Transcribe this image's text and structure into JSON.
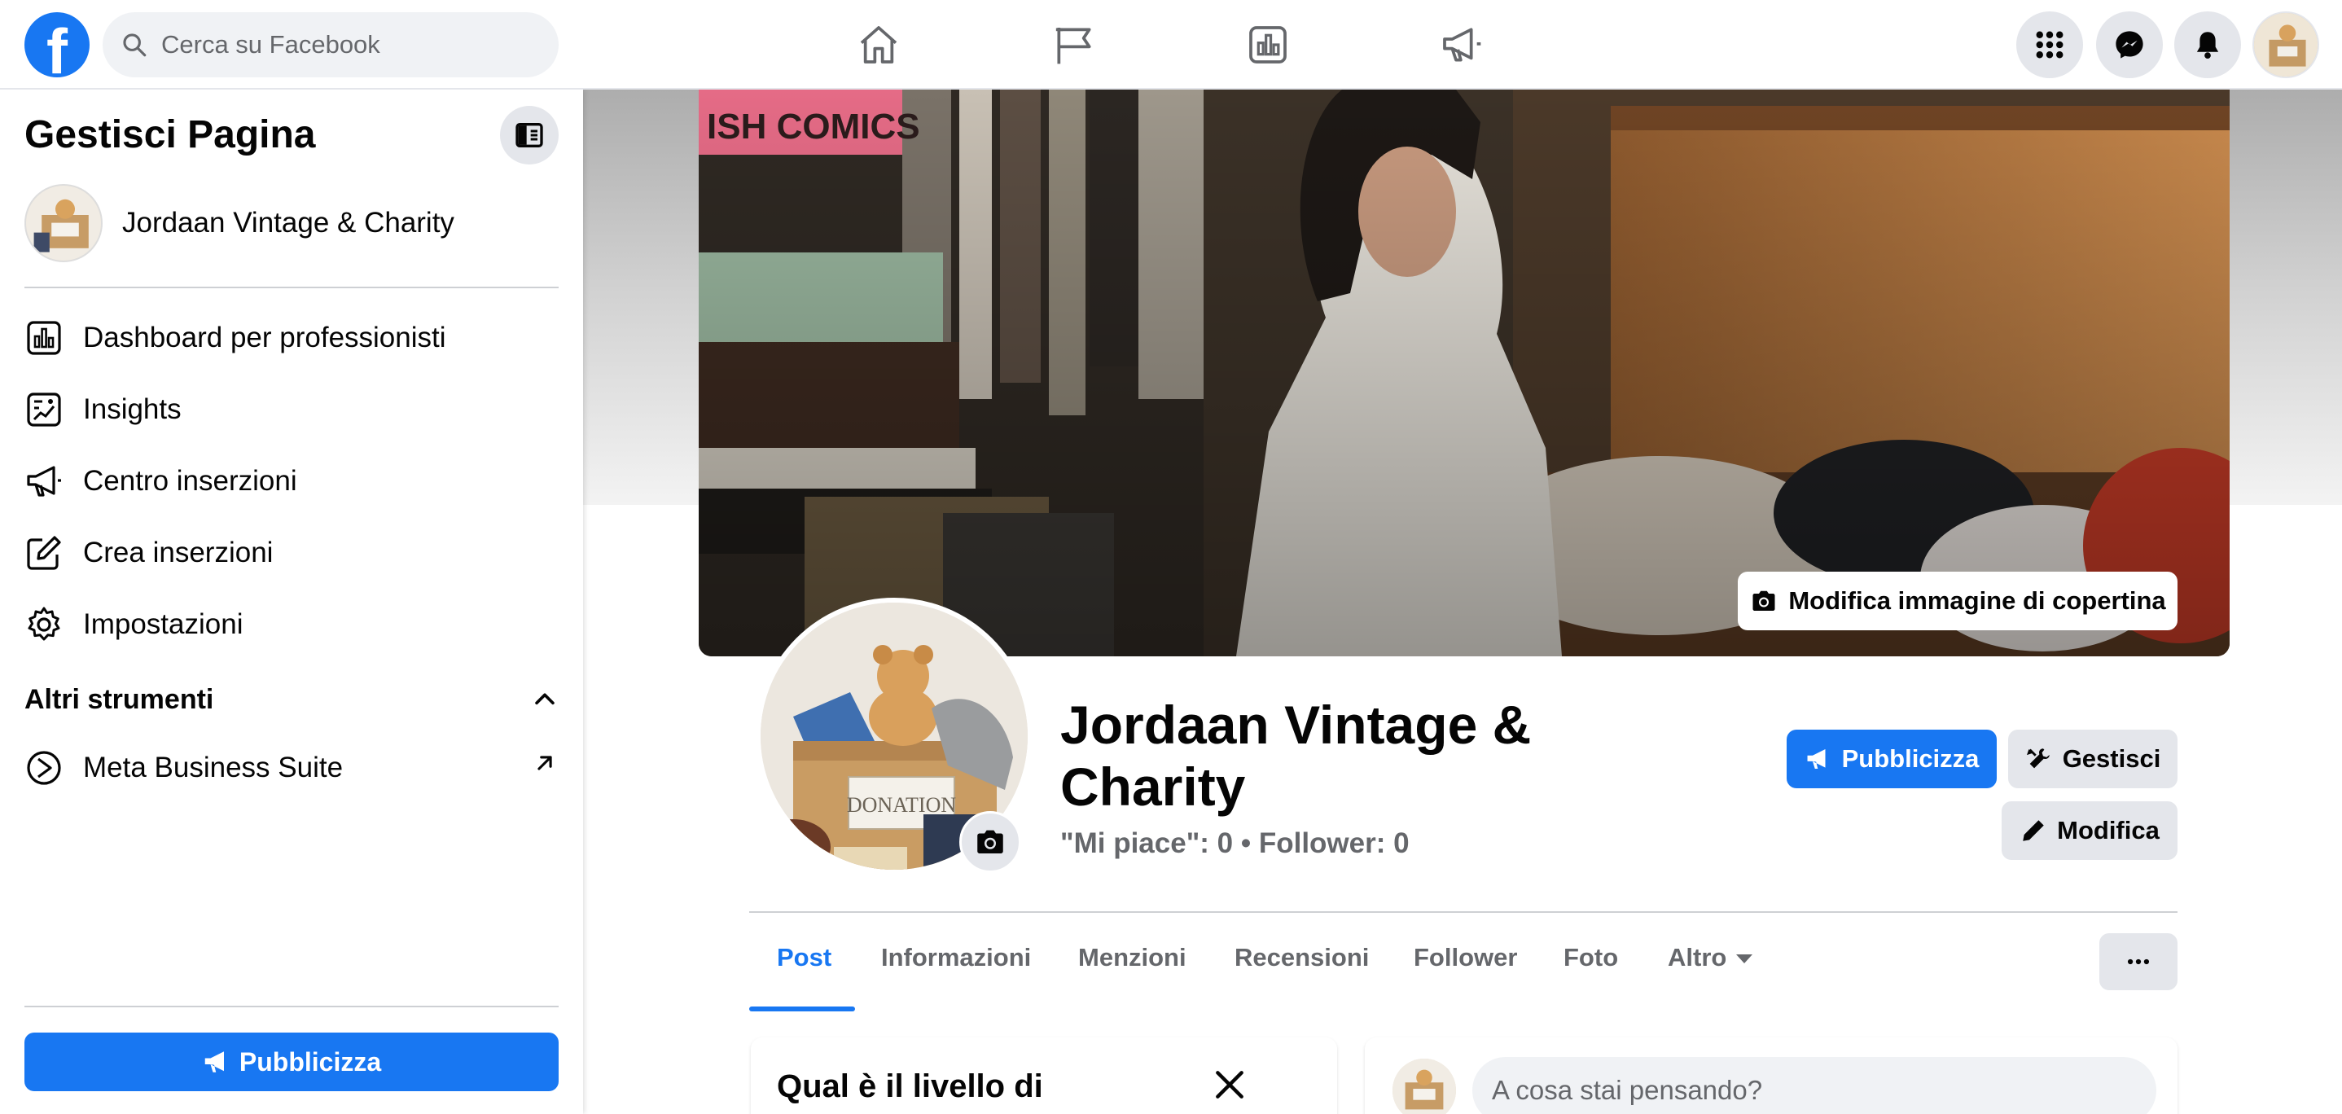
{
  "topbar": {
    "logo_letter": "f",
    "search_placeholder": "Cerca su Facebook"
  },
  "sidebar": {
    "title": "Gestisci Pagina",
    "page_name": "Jordaan Vintage & Charity",
    "items": [
      {
        "label": "Dashboard per professionisti",
        "icon": "dashboard-icon"
      },
      {
        "label": "Insights",
        "icon": "insights-icon"
      },
      {
        "label": "Centro inserzioni",
        "icon": "megaphone-icon"
      },
      {
        "label": "Crea inserzioni",
        "icon": "edit-icon"
      },
      {
        "label": "Impostazioni",
        "icon": "gear-icon"
      }
    ],
    "other_tools_title": "Altri strumenti",
    "meta_business_suite": "Meta Business Suite",
    "promote_button": "Pubblicizza"
  },
  "cover": {
    "edit_cover_label": "Modifica immagine di copertina"
  },
  "profile": {
    "name": "Jordaan Vintage & Charity",
    "stats": "\"Mi piace\": 0 • Follower: 0",
    "box_label": "DONATION"
  },
  "actions": {
    "promote": "Pubblicizza",
    "manage": "Gestisci",
    "edit": "Modifica"
  },
  "tabs": [
    {
      "label": "Post",
      "active": true
    },
    {
      "label": "Informazioni",
      "active": false
    },
    {
      "label": "Menzioni",
      "active": false
    },
    {
      "label": "Recensioni",
      "active": false
    },
    {
      "label": "Follower",
      "active": false
    },
    {
      "label": "Foto",
      "active": false
    },
    {
      "label": "Altro",
      "active": false
    }
  ],
  "cards": {
    "setup_title": "Qual è il livello di completamento della tua",
    "composer_placeholder": "A cosa stai pensando?"
  },
  "colors": {
    "brand_blue": "#1877f2",
    "grey_button": "#e4e6eb",
    "secondary_text": "#65676b"
  }
}
